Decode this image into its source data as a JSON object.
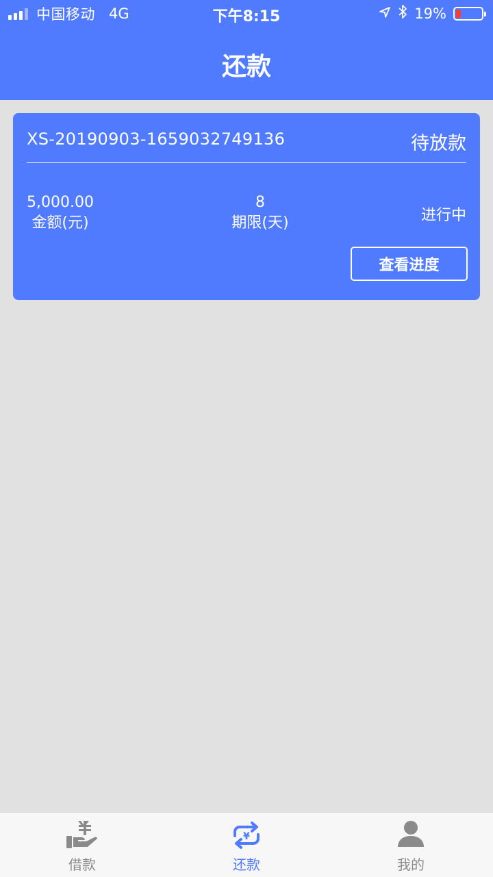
{
  "status_bar": {
    "carrier": "中国移动",
    "network": "4G",
    "time": "下午8:15",
    "battery": "19%",
    "battery_level": 0.19,
    "icons": [
      "signal-icon",
      "location-arrow-icon",
      "bluetooth-icon",
      "battery-icon"
    ]
  },
  "header": {
    "title": "还款"
  },
  "loan": {
    "order_no": "XS-20190903-1659032749136",
    "status": "待放款",
    "amount_value": "5,000.00",
    "amount_label": "金额(元)",
    "term_value": "8",
    "term_label": "期限(天)",
    "progress_status": "进行中",
    "view_progress_label": "查看进度"
  },
  "tabbar": {
    "tabs": [
      {
        "label": "借款",
        "icon": "loan-hand-yen-icon",
        "active": false
      },
      {
        "label": "还款",
        "icon": "repay-cycle-yen-icon",
        "active": true
      },
      {
        "label": "我的",
        "icon": "user-icon",
        "active": false
      }
    ]
  },
  "colors": {
    "primary": "#507bfe",
    "background": "#e1e1e1",
    "tab_inactive": "#8a8a8a",
    "battery_low": "#ff3b30"
  }
}
